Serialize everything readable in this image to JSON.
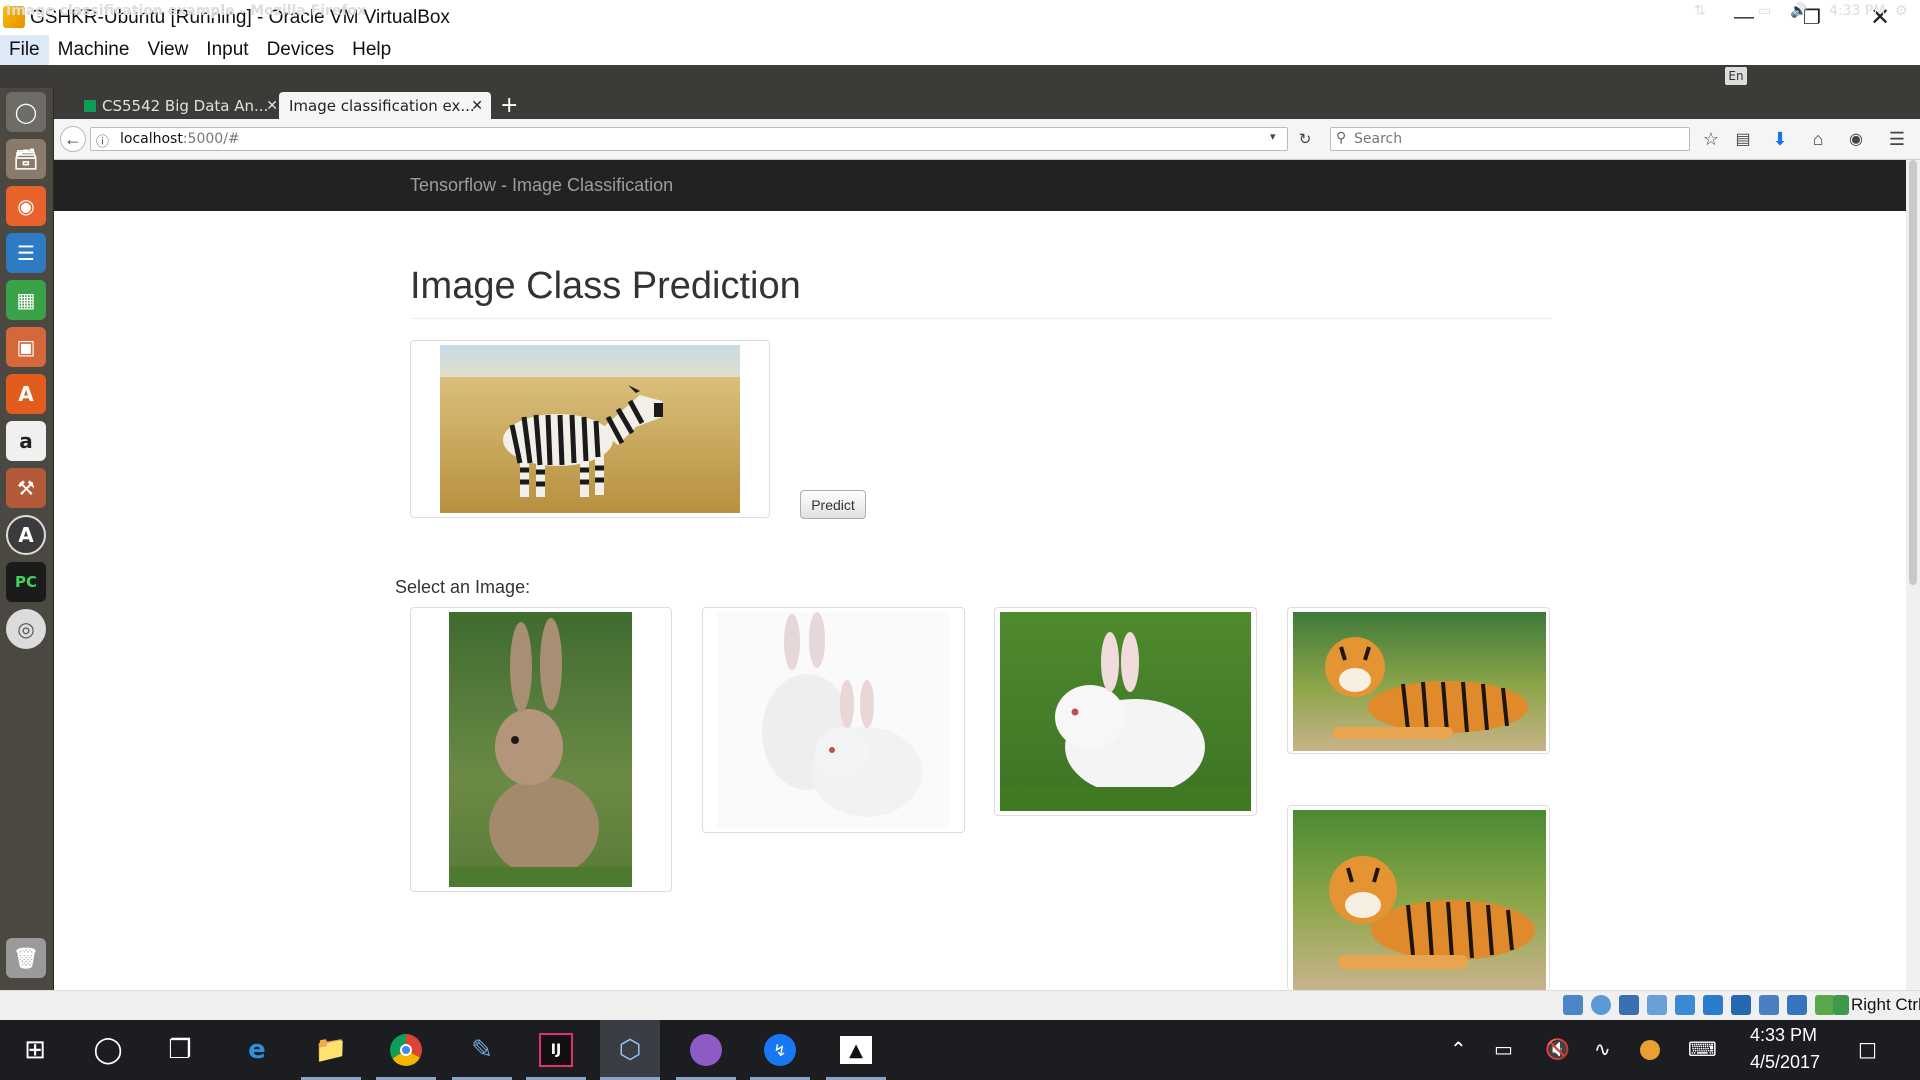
{
  "vbox": {
    "title": "GSHKR-Ubuntu [Running] - Oracle VM VirtualBox",
    "menu": [
      "File",
      "Machine",
      "View",
      "Input",
      "Devices",
      "Help"
    ],
    "host_key": "Right Ctrl"
  },
  "ubuntu": {
    "window_title": "Image classification example - Mozilla Firefox",
    "keyboard_layout": "En",
    "time": "4:33 PM"
  },
  "firefox": {
    "tabs": [
      {
        "label": "CS5542 Big Data An...",
        "active": false
      },
      {
        "label": "Image classification ex...",
        "active": true
      }
    ],
    "new_tab": "+",
    "url_host": "localhost",
    "url_rest": ":5000/#",
    "search_placeholder": "Search"
  },
  "page": {
    "brand": "Tensorflow - Image Classification",
    "heading": "Image Class Prediction",
    "predict_label": "Predict",
    "select_label": "Select an Image:",
    "gallery": [
      "rabbit-brown",
      "rabbits-white-pair",
      "rabbit-white",
      "tiger-1",
      "tiger-2"
    ],
    "selected": "zebra"
  },
  "taskbar": {
    "time": "4:33 PM",
    "date": "4/5/2017"
  },
  "colors": {
    "page_navbar": "#222222",
    "brand_text": "#9d9d9d",
    "ubuntu_panel": "#3c3b37",
    "taskbar": "#1b1d21"
  }
}
